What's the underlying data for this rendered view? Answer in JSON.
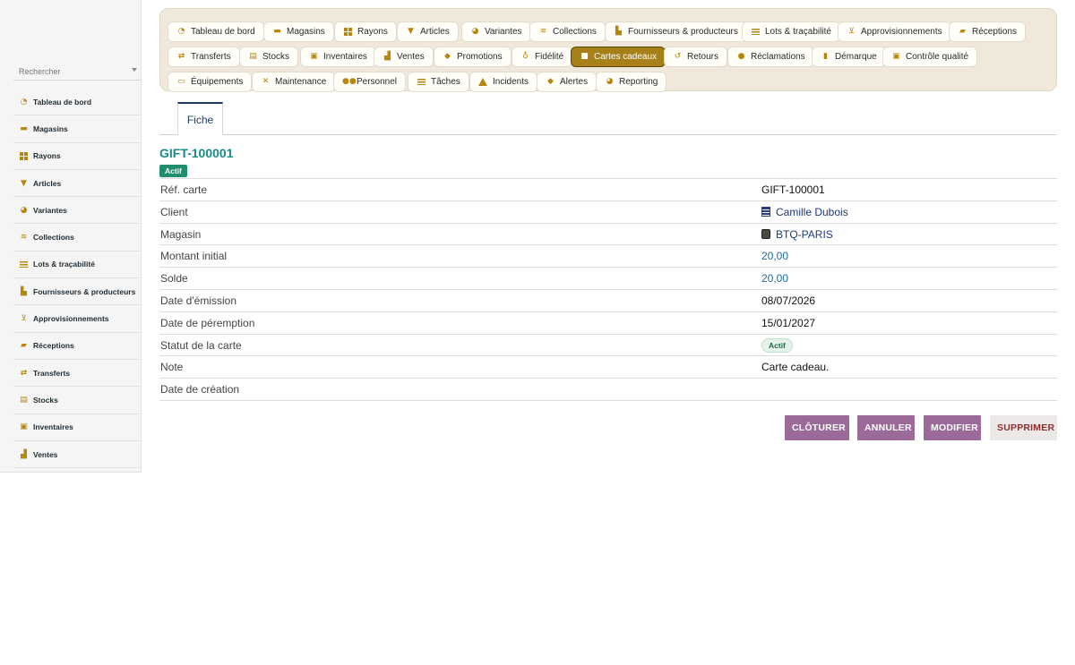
{
  "sidebar": {
    "search_placeholder": "Rechercher",
    "items": [
      {
        "label": "Tableau de bord",
        "icon": "dashboard-icon"
      },
      {
        "label": "Magasins",
        "icon": "store-icon"
      },
      {
        "label": "Rayons",
        "icon": "grid-icon"
      },
      {
        "label": "Articles",
        "icon": "tshirt-icon"
      },
      {
        "label": "Variantes",
        "icon": "palette-icon"
      },
      {
        "label": "Collections",
        "icon": "layers-icon"
      },
      {
        "label": "Lots & traçabilité",
        "icon": "list-icon"
      },
      {
        "label": "Fournisseurs & producteurs",
        "icon": "factory-icon"
      },
      {
        "label": "Approvisionnements",
        "icon": "cart-icon"
      },
      {
        "label": "Réceptions",
        "icon": "truck-icon"
      },
      {
        "label": "Transferts",
        "icon": "transfer-icon"
      },
      {
        "label": "Stocks",
        "icon": "warehouse-icon"
      },
      {
        "label": "Inventaires",
        "icon": "clipboard-icon"
      },
      {
        "label": "Ventes",
        "icon": "cash-register-icon"
      }
    ]
  },
  "modules": [
    {
      "label": "Tableau de bord",
      "icon": "dashboard-icon"
    },
    {
      "label": "Magasins",
      "icon": "store-icon"
    },
    {
      "label": "Rayons",
      "icon": "grid-icon"
    },
    {
      "label": "Articles",
      "icon": "tshirt-icon"
    },
    {
      "label": "Variantes",
      "icon": "palette-icon"
    },
    {
      "label": "Collections",
      "icon": "layers-icon"
    },
    {
      "label": "Fournisseurs & producteurs",
      "icon": "factory-icon"
    },
    {
      "label": "Lots & traçabilité",
      "icon": "list-icon"
    },
    {
      "label": "Approvisionnements",
      "icon": "cart-icon"
    },
    {
      "label": "Réceptions",
      "icon": "truck-icon"
    },
    {
      "label": "Transferts",
      "icon": "transfer-icon"
    },
    {
      "label": "Stocks",
      "icon": "warehouse-icon"
    },
    {
      "label": "Inventaires",
      "icon": "clipboard-icon"
    },
    {
      "label": "Ventes",
      "icon": "cash-register-icon"
    },
    {
      "label": "Promotions",
      "icon": "tags-icon"
    },
    {
      "label": "Fidélité",
      "icon": "award-icon"
    },
    {
      "label": "Cartes cadeaux",
      "icon": "gift-icon",
      "active": true
    },
    {
      "label": "Retours",
      "icon": "undo-icon"
    },
    {
      "label": "Réclamations",
      "icon": "comment-icon"
    },
    {
      "label": "Démarque",
      "icon": "trash-icon"
    },
    {
      "label": "Contrôle qualité",
      "icon": "clipboard-check-icon"
    },
    {
      "label": "Équipements",
      "icon": "desktop-icon"
    },
    {
      "label": "Maintenance",
      "icon": "tools-icon"
    },
    {
      "label": "Personnel",
      "icon": "users-icon"
    },
    {
      "label": "Tâches",
      "icon": "tasks-icon"
    },
    {
      "label": "Incidents",
      "icon": "warning-icon"
    },
    {
      "label": "Alertes",
      "icon": "bell-icon"
    },
    {
      "label": "Reporting",
      "icon": "pie-chart-icon"
    }
  ],
  "tabs": [
    {
      "label": "Fiche",
      "active": true
    }
  ],
  "record": {
    "title": "GIFT-100001",
    "status_badge": "Actif",
    "fields": [
      {
        "label": "Réf. carte",
        "value": "GIFT-100001",
        "kind": "text"
      },
      {
        "label": "Client",
        "value": "Camille Dubois",
        "kind": "link",
        "icon": "building-icon"
      },
      {
        "label": "Magasin",
        "value": "BTQ-PARIS",
        "kind": "link",
        "icon": "store-badge-icon"
      },
      {
        "label": "Montant initial",
        "value": "20,00",
        "kind": "number"
      },
      {
        "label": "Solde",
        "value": "20,00",
        "kind": "number"
      },
      {
        "label": "Date d'émission",
        "value": "08/07/2026",
        "kind": "text"
      },
      {
        "label": "Date de péremption",
        "value": "15/01/2027",
        "kind": "text"
      },
      {
        "label": "Statut de la carte",
        "value": "Actif",
        "kind": "pill"
      },
      {
        "label": "Note",
        "value": "Carte cadeau.",
        "kind": "text"
      },
      {
        "label": "Date de création",
        "value": "",
        "kind": "text"
      }
    ]
  },
  "actions": {
    "close_label": "CLÔTURER",
    "cancel_label": "ANNULER",
    "edit_label": "MODIFIER",
    "delete_label": "SUPPRIMER"
  },
  "colors": {
    "accent_gold": "#b8860b",
    "active_module_bg": "#a8801a",
    "record_title": "#1a8a8a",
    "action_primary": "#9b6a99",
    "action_danger_text": "#8c2f2f"
  }
}
